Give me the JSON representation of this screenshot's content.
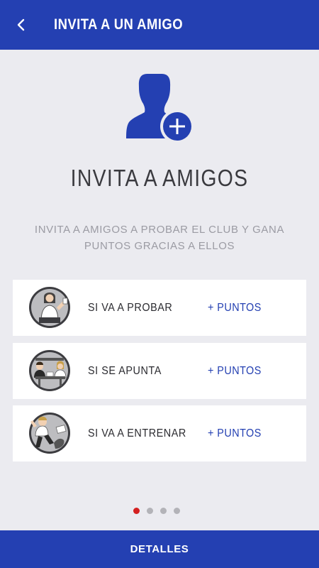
{
  "header": {
    "title": "INVITA A UN AMIGO",
    "back_icon": "chevron-left-icon"
  },
  "hero": {
    "icon": "add-user-icon",
    "heading": "INVITA A AMIGOS",
    "subtitle": "INVITA A AMIGOS A PROBAR EL CLUB Y GANA PUNTOS GRACIAS A ELLOS"
  },
  "cards": [
    {
      "label": "SI VA A PROBAR",
      "points": "+ PUNTOS",
      "avatar": "woman-trying-avatar"
    },
    {
      "label": "SI SE APUNTA",
      "points": "+ PUNTOS",
      "avatar": "signup-desk-avatar"
    },
    {
      "label": "SI VA A ENTRENAR",
      "points": "+ PUNTOS",
      "avatar": "training-avatar"
    }
  ],
  "pager": {
    "count": 4,
    "active_index": 0
  },
  "footer": {
    "button_label": "DETALLES"
  },
  "colors": {
    "brand_blue": "#2440b2",
    "background": "#ebebf0",
    "active_dot": "#d42020"
  }
}
